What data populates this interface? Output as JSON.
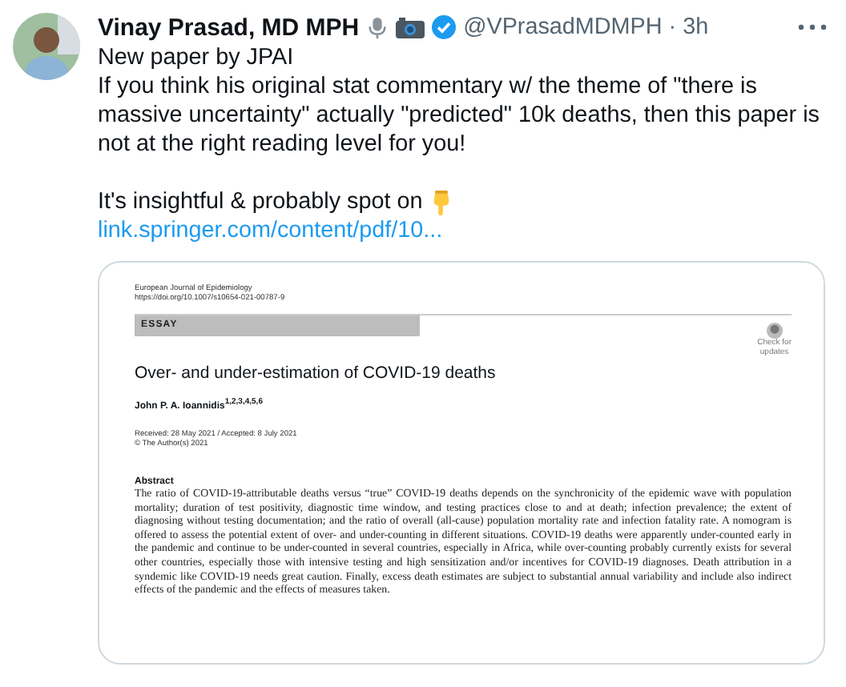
{
  "author": {
    "name": "Vinay Prasad, MD MPH",
    "verified": true,
    "handle": "@VPrasadMDMPH",
    "separator": "·",
    "time": "3h"
  },
  "text": {
    "lines": [
      "New paper by JPAI",
      "If you think his original stat commentary w/ the theme of \"there is massive uncertainty\" actually \"predicted\" 10k deaths, then this paper is not at the right reading level for you!"
    ],
    "closing": "It's insightful & probably spot on",
    "link": "link.springer.com/content/pdf/10..."
  },
  "document": {
    "journal": "European Journal of Epidemiology",
    "doi": "https://doi.org/10.1007/s10654-021-00787-9",
    "section": "ESSAY",
    "badge": [
      "Check for",
      "updates"
    ],
    "title": "Over- and under-estimation of COVID-19 deaths",
    "authors": "John P. A. Ioannidis$^{1,2,3,4,5,6}$",
    "dates": "Received: 28 May 2021 / Accepted: 8 July 2021",
    "copyright": "© The Author(s) 2021",
    "abstract_heading": "Abstract",
    "abstract": "The ratio of COVID-19-attributable deaths versus “true” COVID-19 deaths depends on the synchronicity of the epidemic wave with population mortality; duration of test positivity, diagnostic time window, and testing practices close to and at death; infection prevalence; the extent of diagnosing without testing documentation; and the ratio of overall (all-cause) population mortality rate and infection fatality rate. A nomogram is offered to assess the potential extent of over- and under-counting in different situations. COVID-19 deaths were apparently under-counted early in the pandemic and continue to be under-counted in several countries, especially in Africa, while over-counting probably currently exists for several other countries, especially those with intensive testing and high sensitization and/or incentives for COVID-19 diagnoses. Death attribution in a syndemic like COVID-19 needs great caution. Finally, excess death estimates are subject to substantial annual variability and include also indirect effects of the pandemic and the effects of measures taken."
  }
}
